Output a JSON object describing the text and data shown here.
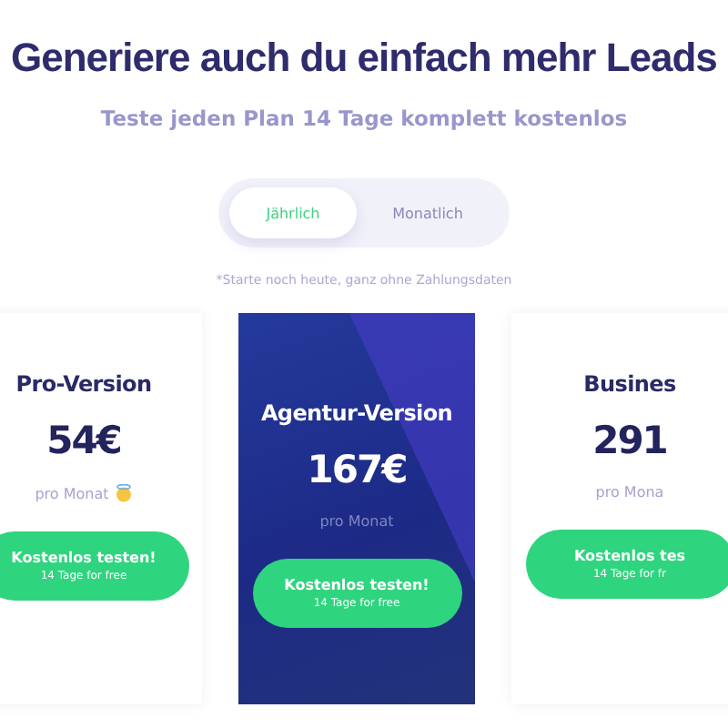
{
  "heading": "Generiere auch du einfach mehr Leads",
  "subheading": "Teste jeden Plan 14 Tage komplett kostenlos",
  "billing_toggle": [
    {
      "label": "Jährlich",
      "selected": true
    },
    {
      "label": "Monatlich",
      "selected": false
    }
  ],
  "note": "*Starte noch heute, ganz ohne Zahlungsdaten",
  "plans": [
    {
      "name": "Pro-Version",
      "price": "54€",
      "period": "pro Monat",
      "emoji": true,
      "featured": false,
      "button": {
        "label": "Kostenlos testen!",
        "sub": "14 Tage for free"
      }
    },
    {
      "name": "Agentur-Version",
      "price": "167€",
      "period": "pro Monat",
      "emoji": false,
      "featured": true,
      "button": {
        "label": "Kostenlos testen!",
        "sub": "14 Tage for free"
      }
    },
    {
      "name": "Busines",
      "price": "291",
      "period": "pro Mona",
      "emoji": false,
      "featured": false,
      "button": {
        "label": "Kostenlos tes",
        "sub": "14 Tage for fr"
      }
    }
  ]
}
